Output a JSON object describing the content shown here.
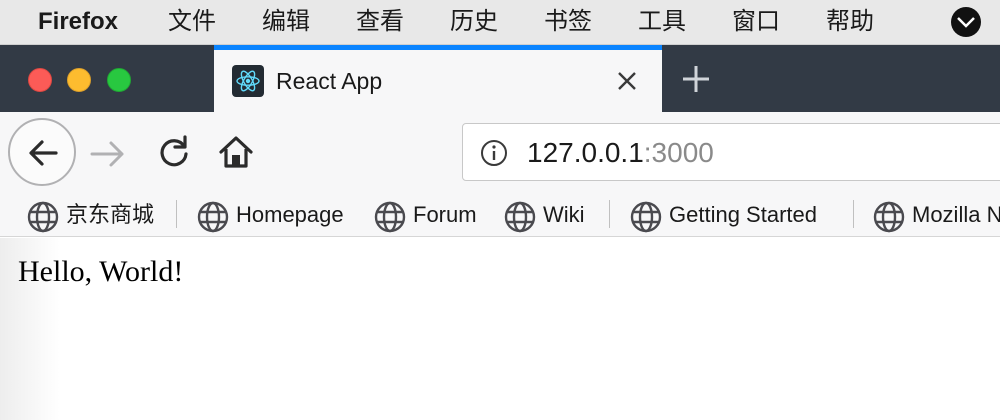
{
  "menubar": {
    "app_name": "Firefox",
    "items": [
      "文件",
      "编辑",
      "查看",
      "历史",
      "书签",
      "工具",
      "窗口",
      "帮助"
    ]
  },
  "tab": {
    "title": "React App",
    "favicon": "react-logo-icon"
  },
  "toolbar": {
    "back_icon": "back-arrow-icon",
    "forward_icon": "forward-arrow-icon",
    "reload_icon": "reload-icon",
    "home_icon": "home-icon"
  },
  "urlbar": {
    "host": "127.0.0.1",
    "port": ":3000",
    "info_icon": "info-icon"
  },
  "bookmarks": {
    "items": [
      {
        "label": "京东商城",
        "icon": "globe-icon"
      },
      {
        "label": "Homepage",
        "icon": "globe-icon"
      },
      {
        "label": "Forum",
        "icon": "globe-icon"
      },
      {
        "label": "Wiki",
        "icon": "globe-icon"
      },
      {
        "label": "Getting Started",
        "icon": "globe-icon"
      },
      {
        "label": "Mozilla N",
        "icon": "globe-icon"
      }
    ]
  },
  "page": {
    "text": "Hello, World!"
  },
  "colors": {
    "tab_accent": "#0a84ff",
    "tabstrip_bg": "#323a45",
    "close_light": "#fc5b57",
    "minimize_light": "#fdbc2f",
    "maximize_light": "#28c840"
  }
}
